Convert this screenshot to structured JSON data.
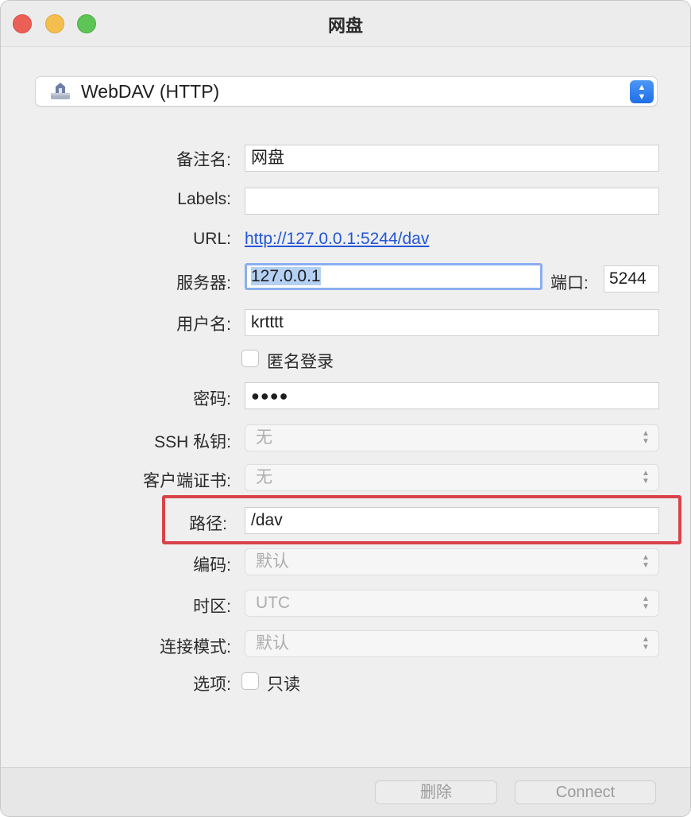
{
  "window": {
    "title": "网盘"
  },
  "protocol": {
    "selected": "WebDAV (HTTP)",
    "icon": "network-drive-icon"
  },
  "form": {
    "nickname": {
      "label": "备注名:",
      "value": "网盘"
    },
    "labels": {
      "label": "Labels:",
      "value": ""
    },
    "url": {
      "label": "URL:",
      "value": "http://127.0.0.1:5244/dav"
    },
    "server": {
      "label": "服务器:",
      "value": "127.0.0.1"
    },
    "port": {
      "label": "端口:",
      "value": "5244"
    },
    "username": {
      "label": "用户名:",
      "value": "krtttt"
    },
    "anonymous": {
      "label": "匿名登录",
      "checked": false
    },
    "password": {
      "label": "密码:",
      "value": "●●●●"
    },
    "ssh_key": {
      "label": "SSH 私钥:",
      "value": "无"
    },
    "client_cert": {
      "label": "客户端证书:",
      "value": "无"
    },
    "path": {
      "label": "路径:",
      "value": "/dav"
    },
    "encoding": {
      "label": "编码:",
      "value": "默认"
    },
    "timezone": {
      "label": "时区:",
      "value": "UTC"
    },
    "connect_mode": {
      "label": "连接模式:",
      "value": "默认"
    },
    "options": {
      "label": "选项:",
      "readonly_label": "只读",
      "readonly_checked": false
    }
  },
  "footer": {
    "delete_label": "删除",
    "connect_label": "Connect"
  },
  "colors": {
    "highlight": "#d9434a",
    "link": "#2156d6",
    "accent": "#1f6fe6"
  }
}
